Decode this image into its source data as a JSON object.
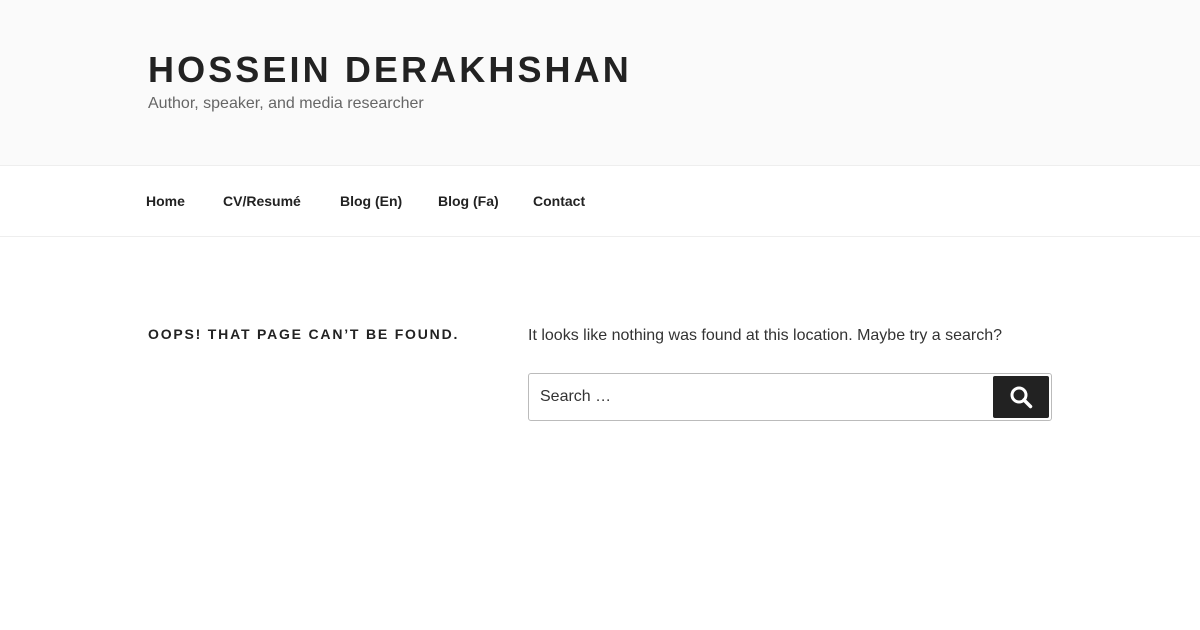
{
  "header": {
    "site_title": "HOSSEIN DERAKHSHAN",
    "site_description": "Author, speaker, and media researcher"
  },
  "nav": {
    "items": [
      {
        "label": "Home"
      },
      {
        "label": "CV/Resumé"
      },
      {
        "label": "Blog (En)"
      },
      {
        "label": "Blog (Fa)"
      },
      {
        "label": "Contact"
      }
    ]
  },
  "main": {
    "heading": "OOPS! THAT PAGE CAN’T BE FOUND.",
    "message": "It looks like nothing was found at this location. Maybe try a search?",
    "search": {
      "placeholder": "Search …",
      "value": "",
      "button_icon": "search-icon"
    }
  },
  "colors": {
    "header_background": "#fafafa",
    "text": "#222222",
    "muted_text": "#666666",
    "search_button": "#222222"
  }
}
